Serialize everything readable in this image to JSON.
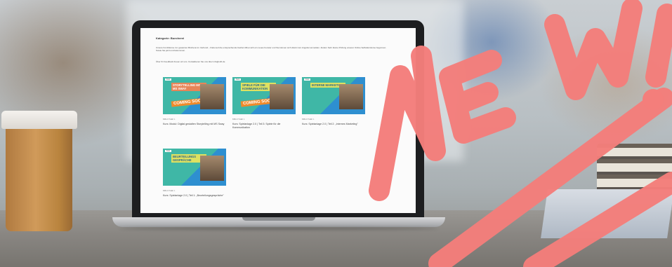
{
  "screen": {
    "heading": "Kategorie: Buecherei",
    "intro": "Unsere Kombikurse zur gesamten Bücherei im Verbund – findet auf die entsprechende Kachel öffnet sich ein neues Fenster und Sie können sich direkt zum Angebot anmelden. Zudem Sehr kleine Prüfung unserer Online Selbstlernkurse begonnen. Sowie Sie jetzt und bekommen.",
    "contact": "Über Ihr Feedback freuen wir uns. Kontaktieren Sie uns über info@vdb.de",
    "cards": [
      {
        "pill": "Kurs",
        "title": "STORYTELLING MIT MS SWAY",
        "badge": "COMING SOON",
        "meta": "BIBLIOTHEK 1",
        "caption": "Kurs: Modul: Digital gestalten Storytelling mit MS Sway"
      },
      {
        "pill": "Kurs",
        "title": "SPIELE FÜR DIE KOMMUNIKATION",
        "badge": "COMING SOON",
        "meta": "BIBLIOTHEK 1",
        "caption": "Kurs: Spielanlage 2.0 | Teil 3: Spiele für die Kommunikation"
      },
      {
        "pill": "Kurs",
        "title": "INTERNE MARKETING",
        "badge": "",
        "meta": "BIBLIOTHEK 1",
        "caption": "Kurs: Spielanlage 2.0 | Teil 2: „Internes Marketing\""
      },
      {
        "pill": "Kurs",
        "title": "BEURTEILUNGS GESPRÄCHE",
        "badge": "",
        "meta": "BIBLIOTHEK 1",
        "caption": "Kurs: Spielanlage 2.0 | Teil 1: „Beurteilungsgespräche\""
      }
    ]
  },
  "overlay": {
    "text": "NEW!",
    "color": "#f47e7b"
  }
}
